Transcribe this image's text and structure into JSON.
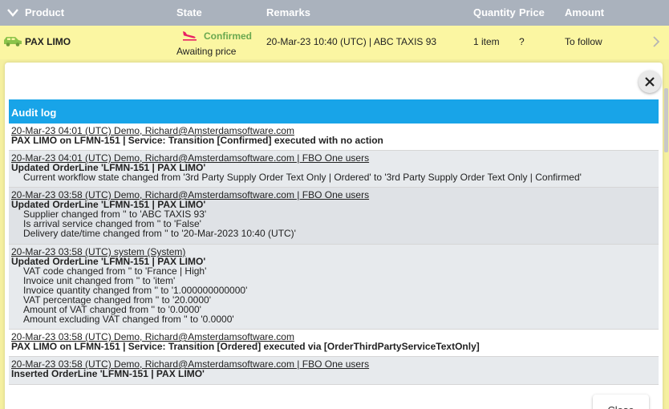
{
  "columns": {
    "product": "Product",
    "state": "State",
    "remarks": "Remarks",
    "quantity": "Quantity",
    "price": "Price",
    "amount": "Amount"
  },
  "row": {
    "product": "PAX LIMO",
    "state": "Confirmed",
    "substate": "Awaiting price",
    "remarks": "20-Mar-23 10:40 (UTC) | ABC TAXIS 93",
    "quantity": "1 item",
    "price": "?",
    "amount": "To follow"
  },
  "audit": {
    "title": "Audit log",
    "entries": [
      {
        "header": "20-Mar-23 04:01 (UTC) Demo, Richard@Amsterdamsoftware.com",
        "summary": "PAX LIMO on LFMN-151 | Service: Transition [Confirmed] executed with no action",
        "details": []
      },
      {
        "header": "20-Mar-23 04:01 (UTC) Demo, Richard@Amsterdamsoftware.com | FBO One users",
        "summary": "Updated OrderLine 'LFMN-151 | PAX LIMO'",
        "details": [
          "Current workflow state changed from '3rd Party Supply Order Text Only | Ordered' to '3rd Party Supply Order Text Only | Confirmed'"
        ]
      },
      {
        "header": "20-Mar-23 03:58 (UTC) Demo, Richard@Amsterdamsoftware.com | FBO One users",
        "summary": "Updated OrderLine 'LFMN-151 | PAX LIMO'",
        "details": [
          "Supplier changed from '' to 'ABC TAXIS 93'",
          "Is arrival service changed from '' to 'False'",
          "Delivery date/time changed from '' to '20-Mar-2023 10:40 (UTC)'"
        ]
      },
      {
        "header": "20-Mar-23 03:58 (UTC) system (System)",
        "summary": "Updated OrderLine 'LFMN-151 | PAX LIMO'",
        "details": [
          "VAT code changed from '' to 'France | High'",
          "Invoice unit changed from '' to 'item'",
          "Invoice quantity changed from '' to '1.000000000000'",
          "VAT percentage changed from '' to '20.0000'",
          "Amount of VAT changed from '' to '0.0000'",
          "Amount excluding VAT changed from '' to '0.0000'"
        ]
      },
      {
        "header": "20-Mar-23 03:58 (UTC) Demo, Richard@Amsterdamsoftware.com",
        "summary": "PAX LIMO on LFMN-151 | Service: Transition [Ordered] executed via [OrderThirdPartyServiceTextOnly]",
        "details": []
      },
      {
        "header": "20-Mar-23 03:58 (UTC) Demo, Richard@Amsterdamsoftware.com | FBO One users",
        "summary": "Inserted OrderLine 'LFMN-151 | PAX LIMO'",
        "details": []
      }
    ]
  },
  "close_label": "Close",
  "icons": {
    "collapse": "chevron-down-icon",
    "product": "car-icon",
    "state": "airplane-landing-icon",
    "row_action": "chevron-right-icon",
    "dismiss": "close-icon"
  },
  "colors": {
    "header_bg": "#aab2bd",
    "row_bg": "#fbf6a2",
    "confirmed": "#6aa84f",
    "audit_header": "#18a4e8",
    "car_icon": "#8bc34a",
    "plane_icon": "#e91e63"
  }
}
